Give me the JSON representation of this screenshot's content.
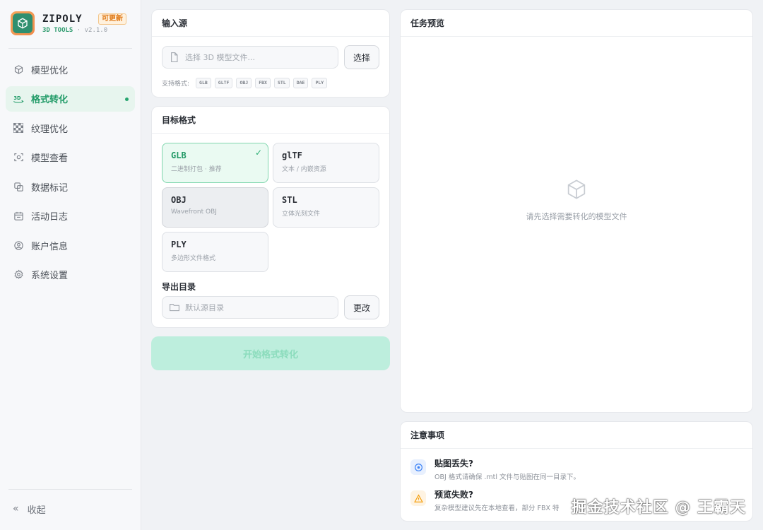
{
  "brand": {
    "name": "ZIPOLY",
    "badge": "可更新",
    "sub": "3D TOOLS",
    "version": "· v2.1.0"
  },
  "nav": {
    "items": [
      {
        "label": "模型优化",
        "icon": "cube-icon"
      },
      {
        "label": "格式转化",
        "icon": "3d-convert-icon",
        "active": true
      },
      {
        "label": "纹理优化",
        "icon": "checker-icon"
      },
      {
        "label": "模型查看",
        "icon": "view-scan-icon"
      },
      {
        "label": "数据标记",
        "icon": "tag-copy-icon"
      },
      {
        "label": "活动日志",
        "icon": "calendar-log-icon"
      },
      {
        "label": "账户信息",
        "icon": "user-circle-icon"
      },
      {
        "label": "系统设置",
        "icon": "gear-icon"
      }
    ],
    "collapse_label": "收起"
  },
  "input_source": {
    "title": "输入源",
    "placeholder": "选择 3D 模型文件...",
    "select_button": "选择",
    "supported_label": "支持格式:",
    "formats": [
      "GLB",
      "GLTF",
      "OBJ",
      "FBX",
      "STL",
      "DAE",
      "PLY"
    ]
  },
  "target_format": {
    "title": "目标格式",
    "options": [
      {
        "name": "GLB",
        "desc": "二进制打包 · 推荐",
        "state": "selected"
      },
      {
        "name": "glTF",
        "desc": "文本 / 内嵌资源",
        "state": "normal"
      },
      {
        "name": "OBJ",
        "desc": "Wavefront OBJ",
        "state": "hover"
      },
      {
        "name": "STL",
        "desc": "立体光刻文件",
        "state": "normal"
      },
      {
        "name": "PLY",
        "desc": "多边形文件格式",
        "state": "normal"
      }
    ],
    "check_mark": "✓",
    "export_label": "导出目录",
    "export_placeholder": "默认源目录",
    "change_button": "更改"
  },
  "start_button": "开始格式转化",
  "preview": {
    "title": "任务预览",
    "empty_text": "请先选择需要转化的模型文件"
  },
  "notes": {
    "title": "注意事项",
    "items": [
      {
        "title": "贴图丢失?",
        "desc": "OBJ 格式请确保 .mtl 文件与贴图在同一目录下。",
        "icon": "info-circle-icon",
        "color": "#3b82f6"
      },
      {
        "title": "预览失败?",
        "desc": "复杂模型建议先在本地查看，部分 FBX 特",
        "icon": "warning-triangle-icon",
        "color": "#f59e0b"
      }
    ]
  },
  "watermark": "掘金技术社区 @ 王霸天"
}
